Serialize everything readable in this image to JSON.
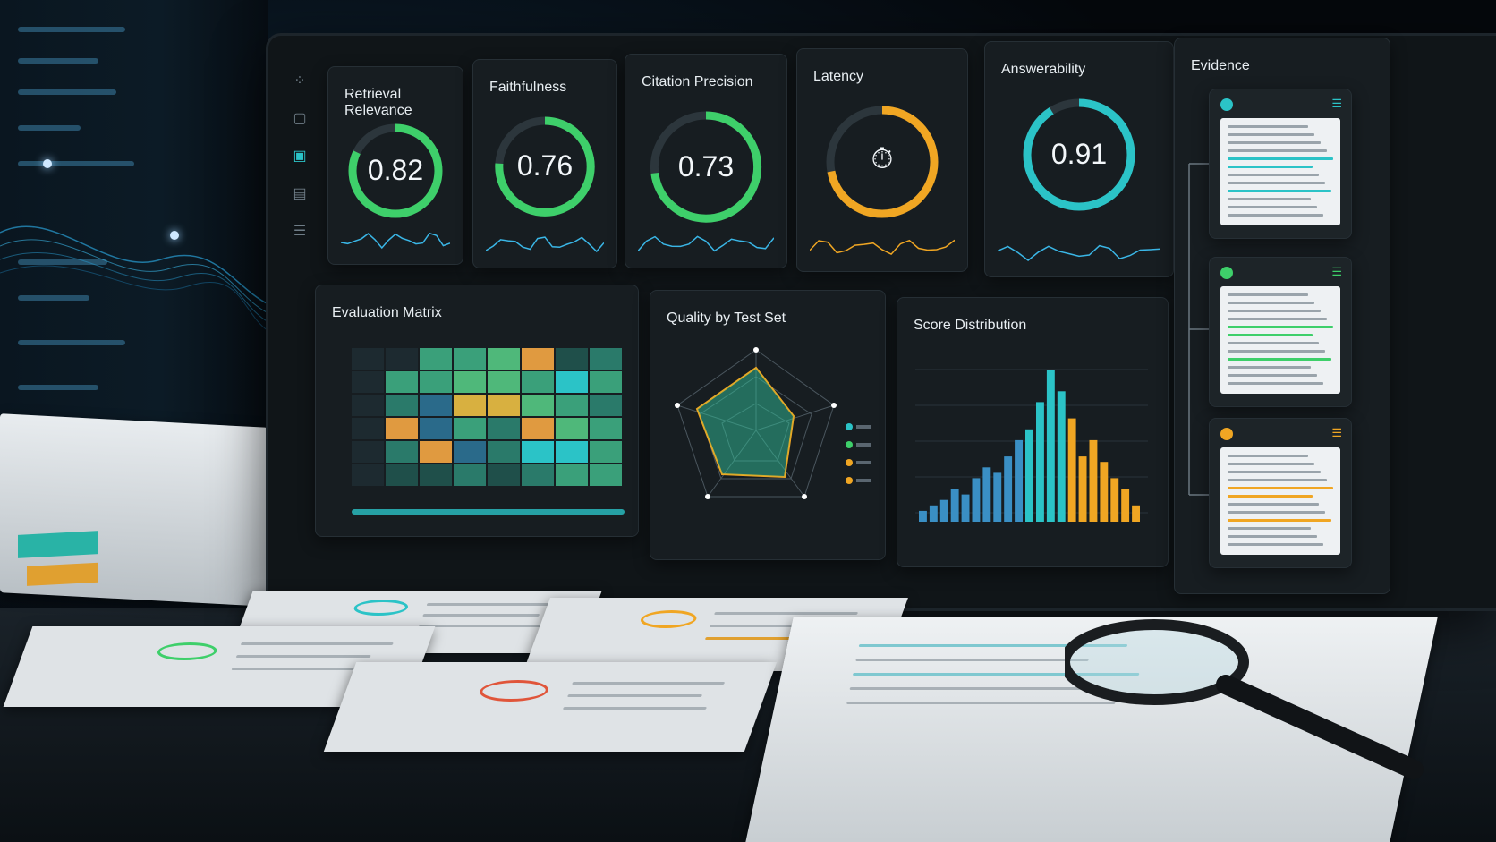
{
  "dashboard": {
    "kpis": [
      {
        "title": "Retrieval Relevance",
        "value": "0.82",
        "fraction": 0.82,
        "color": "#3ecf6a"
      },
      {
        "title": "Faithfulness",
        "value": "0.76",
        "fraction": 0.76,
        "color": "#3ecf6a"
      },
      {
        "title": "Citation Precision",
        "value": "0.73",
        "fraction": 0.73,
        "color": "#3ecf6a"
      },
      {
        "title": "Latency",
        "value": "",
        "fraction": 0.72,
        "color": "#f0a623",
        "icon": "stopwatch-icon"
      },
      {
        "title": "Answerability",
        "value": "0.91",
        "fraction": 0.91,
        "color": "#2bc3c7"
      }
    ],
    "evaluation_matrix": {
      "title": "Evaluation Matrix"
    },
    "quality_by_test_set": {
      "title": "Quality by Test Set"
    },
    "score_distribution": {
      "title": "Score Distribution"
    },
    "evidence": {
      "title": "Evidence"
    }
  },
  "chart_data": [
    {
      "type": "bar",
      "title": "Score Distribution",
      "values": [
        2,
        3,
        4,
        6,
        5,
        8,
        10,
        9,
        12,
        15,
        17,
        22,
        28,
        24,
        19,
        12,
        15,
        11,
        8,
        6,
        3
      ],
      "colors_by_segment": [
        "#3a8fc4",
        "#2bc3c7",
        "#f0a623"
      ]
    }
  ],
  "colors": {
    "accent_green": "#3ecf6a",
    "accent_teal": "#2bc3c7",
    "accent_orange": "#f0a623",
    "panel": "#171d21"
  }
}
